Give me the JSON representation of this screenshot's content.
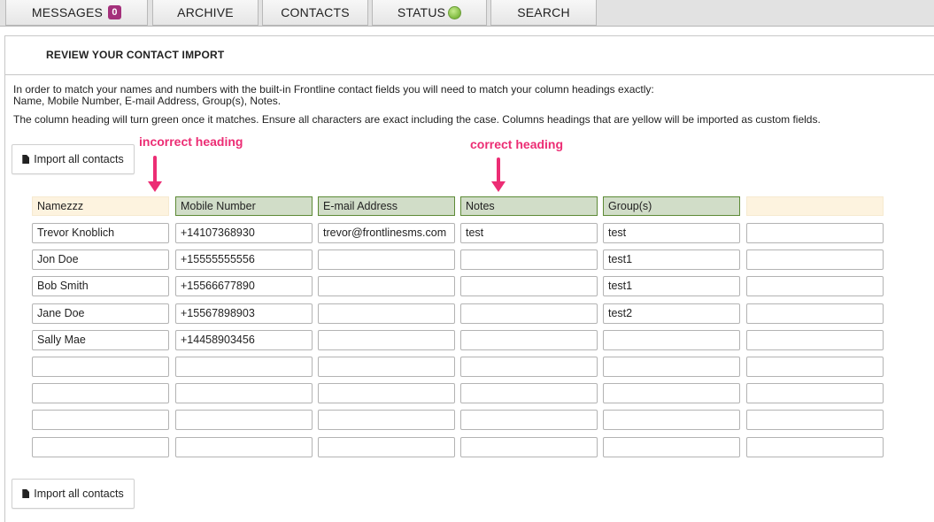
{
  "tabs": [
    {
      "label": "MESSAGES",
      "badge": "0"
    },
    {
      "label": "ARCHIVE"
    },
    {
      "label": "CONTACTS"
    },
    {
      "label": "STATUS",
      "status_color": "#7fba3f"
    },
    {
      "label": "SEARCH"
    }
  ],
  "section_title": "REVIEW YOUR CONTACT IMPORT",
  "instructions": {
    "line1": "In order to match your names and numbers with the built-in Frontline contact fields you will need to match your column headings exactly:",
    "line2": "Name, Mobile Number, E-mail Address, Group(s), Notes.",
    "line3": "The column heading will turn green once it matches. Ensure all characters are exact including the case. Columns headings that are yellow will be imported as custom fields."
  },
  "import_button_label": "Import all contacts",
  "annotations": {
    "incorrect": "incorrect heading",
    "correct": "correct heading"
  },
  "colors": {
    "matched_heading": "#d1ddc8",
    "custom_heading": "#fdf3df",
    "annotation": "#ec2d74",
    "badge": "#a4307b"
  },
  "columns": [
    {
      "heading": "Namezzz",
      "state": "custom"
    },
    {
      "heading": "Mobile Number",
      "state": "matched"
    },
    {
      "heading": "E-mail Address",
      "state": "matched"
    },
    {
      "heading": "Notes",
      "state": "matched"
    },
    {
      "heading": "Group(s)",
      "state": "matched"
    },
    {
      "heading": "",
      "state": "custom"
    }
  ],
  "rows": [
    [
      "Trevor Knoblich",
      "+14107368930",
      "trevor@frontlinesms.com",
      "test",
      "test",
      ""
    ],
    [
      "Jon Doe",
      "+15555555556",
      "",
      "",
      "test1",
      ""
    ],
    [
      "Bob Smith",
      "+15566677890",
      "",
      "",
      "test1",
      ""
    ],
    [
      "Jane Doe",
      "+15567898903",
      "",
      "",
      "test2",
      ""
    ],
    [
      "Sally Mae",
      "+14458903456",
      "",
      "",
      "",
      ""
    ],
    [
      "",
      "",
      "",
      "",
      "",
      ""
    ],
    [
      "",
      "",
      "",
      "",
      "",
      ""
    ],
    [
      "",
      "",
      "",
      "",
      "",
      ""
    ],
    [
      "",
      "",
      "",
      "",
      "",
      ""
    ]
  ]
}
